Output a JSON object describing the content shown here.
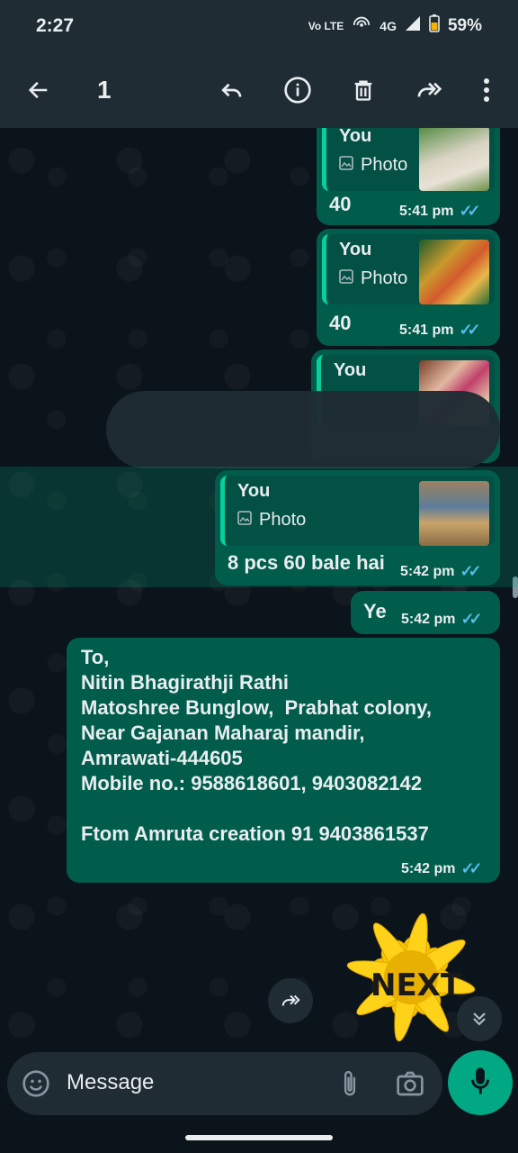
{
  "status_bar": {
    "time": "2:27",
    "volte": "Vo LTE",
    "network": "4G",
    "battery": "59%"
  },
  "action_bar": {
    "selected_count": "1"
  },
  "messages": [
    {
      "quote_name": "You",
      "quote_type": "Photo",
      "text": "40",
      "time": "5:41 pm"
    },
    {
      "quote_name": "You",
      "quote_type": "Photo",
      "text": "40",
      "time": "5:41 pm"
    },
    {
      "quote_name": "You"
    },
    {
      "quote_name": "You",
      "quote_type": "Photo",
      "text": "8 pcs 60 bale hai",
      "time": "5:42 pm"
    },
    {
      "text": "Ye",
      "time": "5:42 pm"
    },
    {
      "lines": [
        "To,",
        "Nitin Bhagirathji Rathi",
        "Matoshree Bunglow,  Prabhat colony,",
        "Near Gajanan Maharaj mandir,",
        "Amrawati-444605",
        "Mobile no.: 9588618601, 9403082142",
        "",
        "Ftom Amruta creation 91 9403861537"
      ],
      "time": "5:42 pm"
    }
  ],
  "sticker": {
    "label": "NEXT"
  },
  "composer": {
    "placeholder": "Message"
  },
  "colors": {
    "bubble": "#005c4b",
    "accent": "#00a884",
    "ticks": "#53bdeb"
  }
}
